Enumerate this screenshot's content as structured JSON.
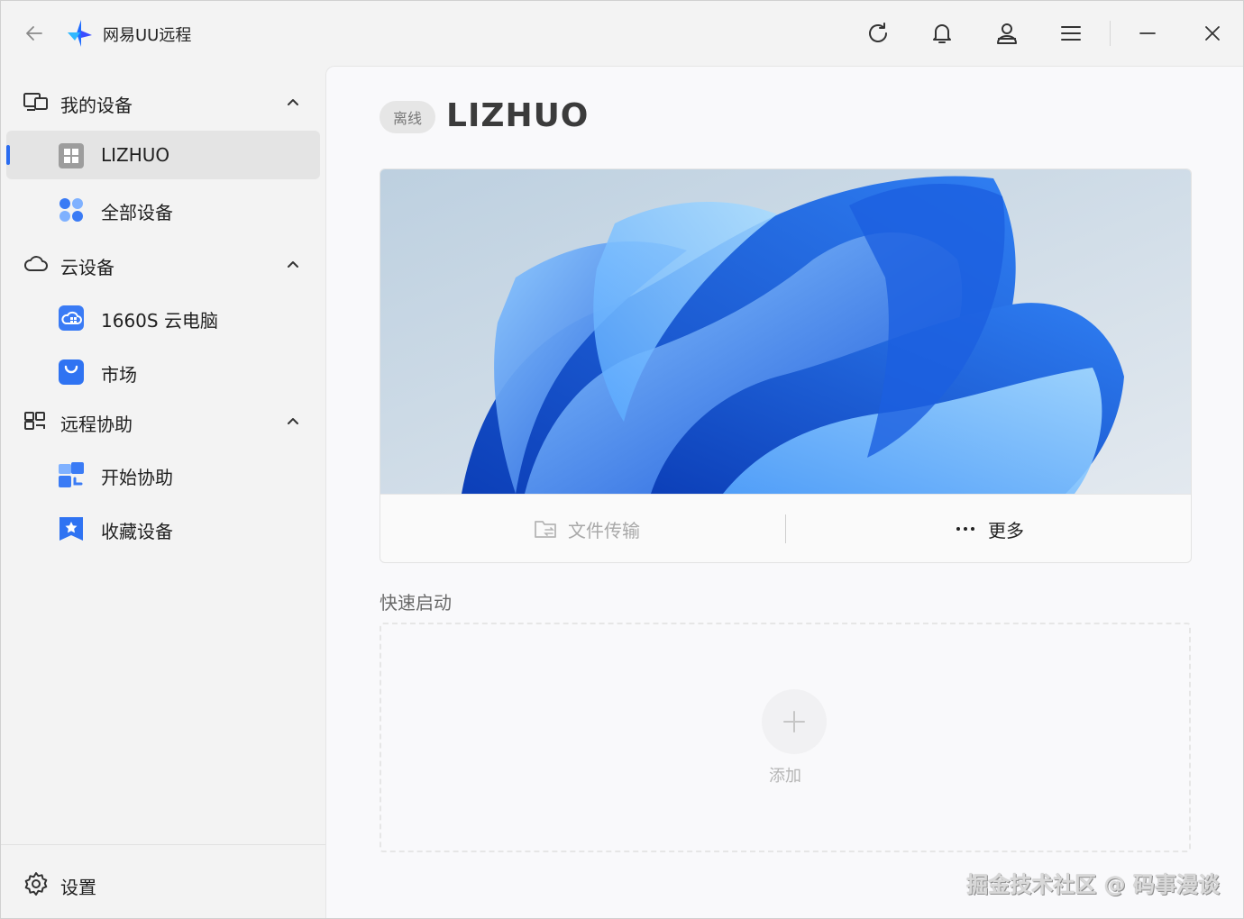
{
  "app": {
    "title": "网易UU远程"
  },
  "sidebar": {
    "groups": [
      {
        "label": "我的设备",
        "items": [
          {
            "label": "LIZHUO"
          },
          {
            "label": "全部设备"
          }
        ]
      },
      {
        "label": "云设备",
        "items": [
          {
            "label": "1660S 云电脑"
          },
          {
            "label": "市场"
          }
        ]
      },
      {
        "label": "远程协助",
        "items": [
          {
            "label": "开始协助"
          },
          {
            "label": "收藏设备"
          }
        ]
      }
    ],
    "settings_label": "设置"
  },
  "main": {
    "status": "离线",
    "device_name": "LIZHUO",
    "actions": {
      "file_transfer": "文件传输",
      "more": "更多"
    },
    "quick_launch": {
      "title": "快速启动",
      "add_label": "添加"
    }
  },
  "watermark": "掘金技术社区 @ 码事漫谈",
  "colors": {
    "accent": "#2a6cf0",
    "sidebar_bg": "#f3f3f3",
    "main_bg": "#f9f9fb"
  }
}
